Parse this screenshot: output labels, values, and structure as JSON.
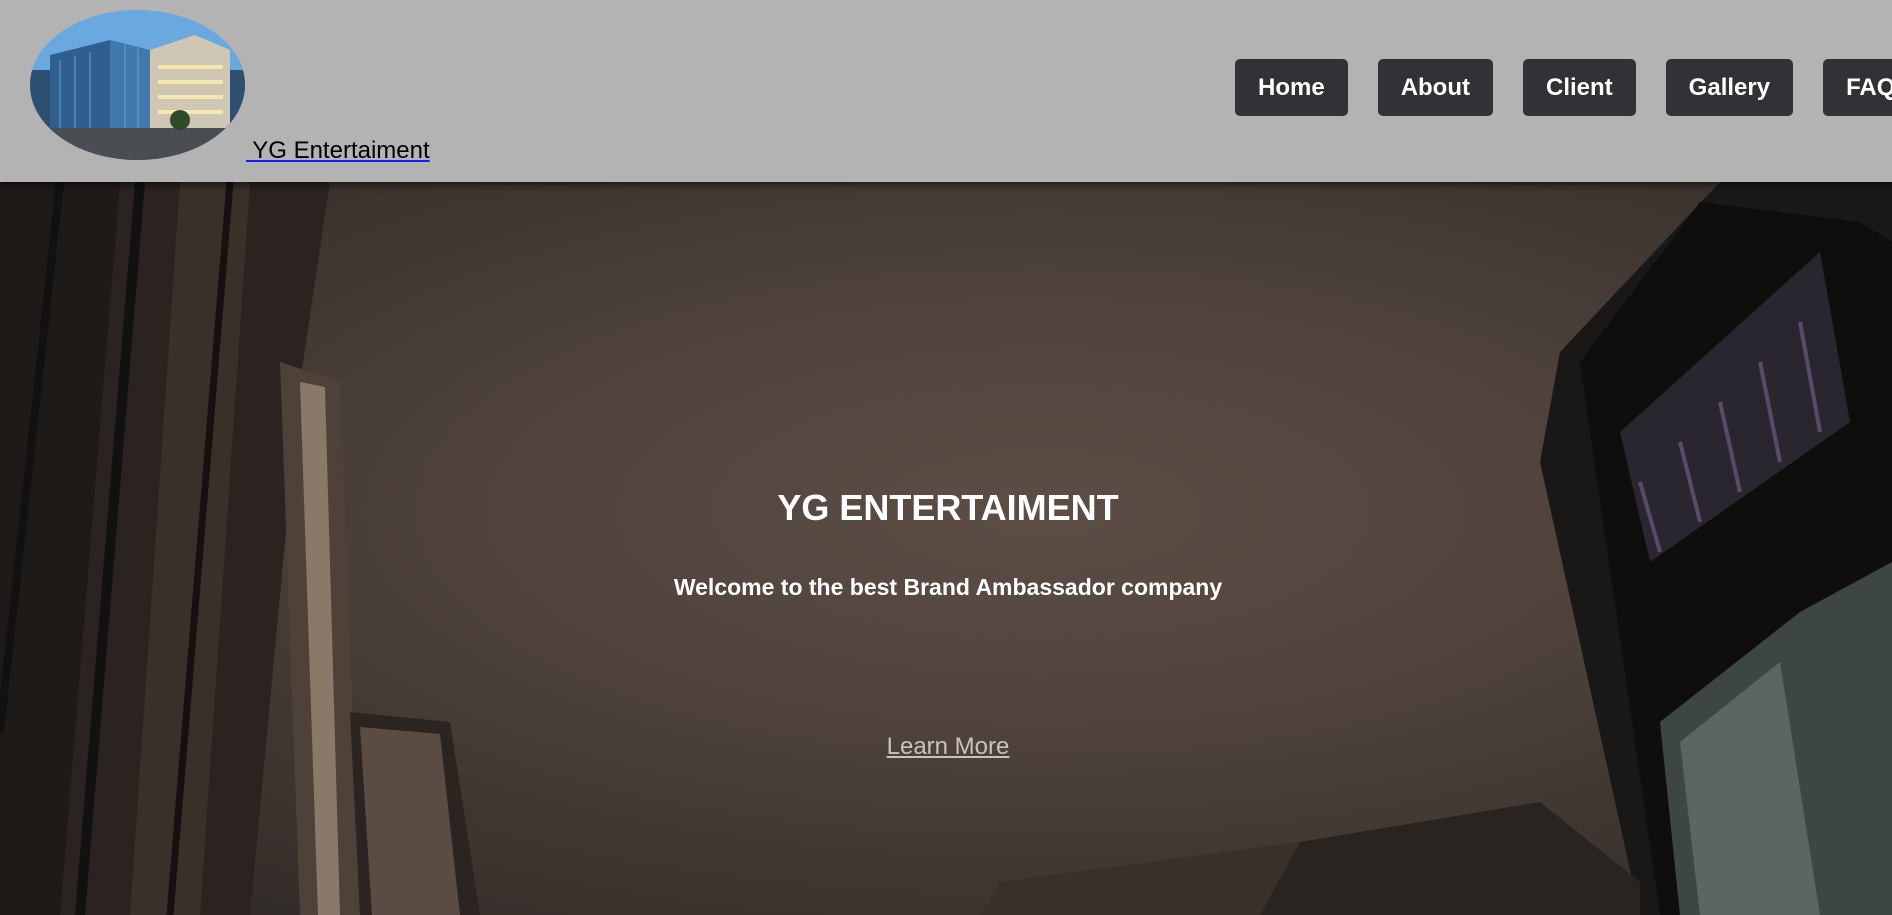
{
  "header": {
    "logo_icon": "building-photo",
    "brand_link": " YG Entertaiment"
  },
  "nav": {
    "items": [
      {
        "label": "Home"
      },
      {
        "label": "About"
      },
      {
        "label": "Client"
      },
      {
        "label": "Gallery"
      },
      {
        "label": "FAQ"
      }
    ]
  },
  "hero": {
    "title": "YG ENTERTAIMENT",
    "subtitle": "Welcome to the best Brand Ambassador company",
    "cta": "Learn More"
  },
  "colors": {
    "header_bg": "#b3b3b3",
    "nav_button_bg": "#323236",
    "hero_text": "#ffffff",
    "link_text": "#c8c3bf"
  }
}
